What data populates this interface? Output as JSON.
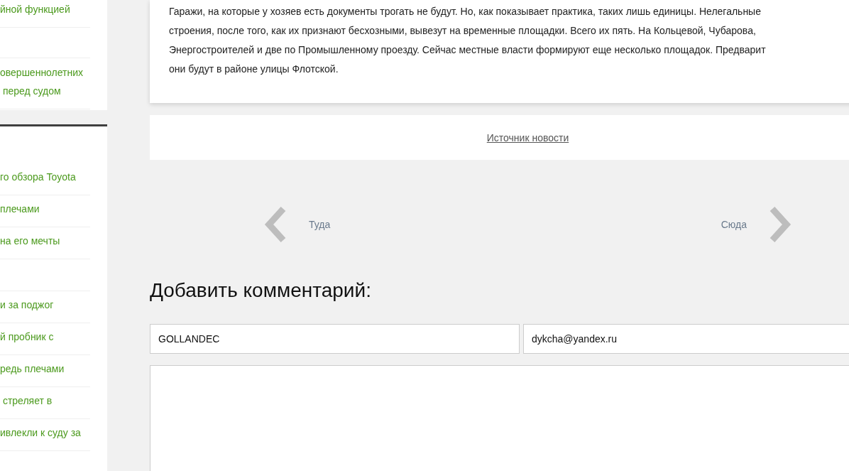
{
  "sidebar": {
    "top_items": [
      {
        "kind": "link",
        "text": "йной функцией"
      },
      {
        "kind": "blank"
      },
      {
        "text": "овершеннолетних\n перед судом"
      }
    ],
    "bottom_items": [
      {
        "text": "го обзора Toyota"
      },
      {
        "text": "плечами"
      },
      {
        "text": "на его мечты"
      },
      {
        "kind": "blank"
      },
      {
        "text": "и за поджог"
      },
      {
        "text": "й пробник с"
      },
      {
        "text": "редь плечами"
      },
      {
        "text": " стреляет в"
      },
      {
        "text": "ивлекли к суду за"
      }
    ]
  },
  "article": {
    "lines": [
      "Гаражи, на которые у хозяев есть документы трогать не будут. Но, как показывает практика, таких лишь единицы. Нелегальные",
      "строения, после того, как их признают бесхозными, вывезут на временные площадки. Всего их пять. На Кольцевой, Чубарова,",
      "Энергостроителей и две по Промышленному проезду. Сейчас местные власти формируют еще несколько площадок. Предварит",
      "они будут в районе улицы Флотской."
    ]
  },
  "source_link": "Источник новости",
  "pager": {
    "prev": "Туда",
    "next": "Сюда"
  },
  "comment_form": {
    "heading": "Добавить комментарий:",
    "name": "GOLLANDEC",
    "email": "dykcha@yandex.ru"
  }
}
